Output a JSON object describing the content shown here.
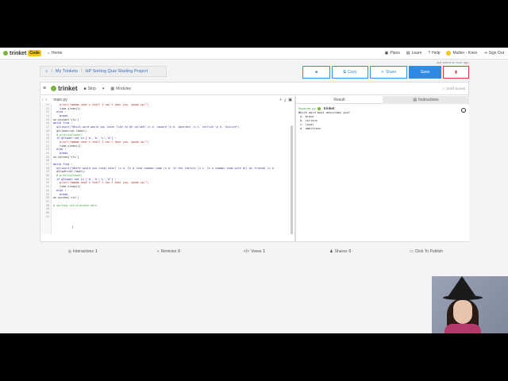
{
  "topnav": {
    "logo_text": "trinket",
    "logo_badge": "Code",
    "home": "Home",
    "links": [
      "Plans",
      "Learn",
      "Help"
    ],
    "user": "Mullen - Krein",
    "signout": "Sign Out"
  },
  "breadcrumb": {
    "folder": "My Trinkets",
    "project": "HP Sorting Quiz Starting Project"
  },
  "last_saved": "last saved an hour ago",
  "buttons": {
    "run_icon": "folder-icon",
    "copy": "Copy",
    "share": "Share",
    "save": "Save"
  },
  "toolbar": {
    "logo_text": "trinket",
    "stop": "Stop",
    "modules": "Modules",
    "autosave": "Draft Saved"
  },
  "file": {
    "name": "main.py"
  },
  "code": [
    {
      "n": "11",
      "t": "    print(\"mmmmm what's that? I can't hear you, speak up!\")",
      "c": "str"
    },
    {
      "n": "12",
      "t": "    time.sleep(1)",
      "c": ""
    },
    {
      "n": "13",
      "t": "  else :",
      "c": "kw"
    },
    {
      "n": "14",
      "t": "    break",
      "c": "kw"
    },
    {
      "n": "15",
      "t": "os.system('cls')",
      "c": ""
    },
    {
      "n": "16",
      "t": "while True :",
      "c": "kw"
    },
    {
      "n": "17",
      "t": "  q2=input(\"Which word would you least like to be called? \\n a. coward \\n b. ignorant \\n c. selfish \\n d. failure\")",
      "c": "var"
    },
    {
      "n": "18",
      "t": "  q2=lower=q2.lower()",
      "c": ""
    },
    {
      "n": "19",
      "t": "  # print(q2lower)",
      "c": "cmt"
    },
    {
      "n": "20",
      "t": "  if q2lower not in ['a','b','c','d'] :",
      "c": "kw"
    },
    {
      "n": "21",
      "t": "    print(\"mmmmm what's that? I can't hear you, speak up!\")",
      "c": "str"
    },
    {
      "n": "22",
      "t": "    time.sleep(1)",
      "c": ""
    },
    {
      "n": "23",
      "t": "  else :",
      "c": "kw"
    },
    {
      "n": "24",
      "t": "    break",
      "c": "kw"
    },
    {
      "n": "25",
      "t": "os.system('cls')",
      "c": ""
    },
    {
      "n": "26",
      "t": "",
      "c": ""
    },
    {
      "n": "27",
      "t": "while True :",
      "c": "kw"
    },
    {
      "n": "28",
      "t": "  q3=input(\"Where would you study best? \\n a. In a loud common room \\n b. In the library \\n c. In a common room with all my friends \\n d",
      "c": "var"
    },
    {
      "n": "29",
      "t": "  q3lower=q3.lower()",
      "c": ""
    },
    {
      "n": "30",
      "t": "  # print(q3lower)",
      "c": "cmt"
    },
    {
      "n": "31",
      "t": "  if q3lower not in ['a','b','c','d'] :",
      "c": "kw"
    },
    {
      "n": "32",
      "t": "    print(\"mmmmm what's that? I can't hear you, speak up!\")",
      "c": "str"
    },
    {
      "n": "33",
      "t": "    time.sleep(1)",
      "c": ""
    },
    {
      "n": "34",
      "t": "  else :",
      "c": "kw"
    },
    {
      "n": "35",
      "t": "    break",
      "c": "kw"
    },
    {
      "n": "36",
      "t": "os.system('cls')",
      "c": ""
    },
    {
      "n": "37",
      "t": "",
      "c": ""
    },
    {
      "n": "38",
      "t": "# sorting calculations here",
      "c": "cmt"
    },
    {
      "n": "39",
      "t": "",
      "c": ""
    },
    {
      "n": "40",
      "t": "",
      "c": ""
    },
    {
      "n": "41",
      "t": "",
      "c": ""
    }
  ],
  "result": {
    "tab_result": "Result",
    "tab_instructions": "Instructions",
    "powered_by": "Powered by",
    "powered_logo": "trinket",
    "output": [
      "Which word best describes you?",
      " a. brave",
      " b. curious",
      " c. loyal",
      " d. ambitious"
    ]
  },
  "stats": [
    {
      "label": "Interactions",
      "count": "1"
    },
    {
      "label": "Remixes",
      "count": "0"
    },
    {
      "label": "Views",
      "count": "1"
    },
    {
      "label": "Shares",
      "count": "0"
    },
    {
      "label": "Click To Publish",
      "count": ""
    }
  ],
  "colors": {
    "accent": "#2f8ae5",
    "brand_green": "#7cb342",
    "brand_yellow": "#f5c518"
  }
}
